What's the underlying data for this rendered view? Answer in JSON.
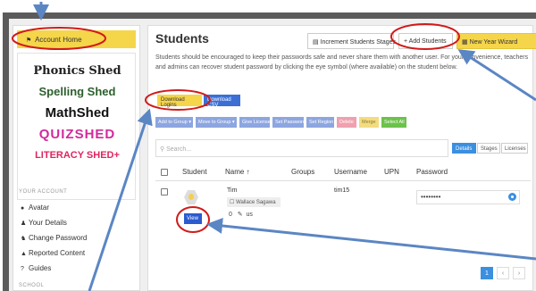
{
  "sidebar": {
    "account_home": "Account Home",
    "logos": [
      "Phonics Shed",
      "Spelling Shed",
      "MathShed",
      "QUIZSHED",
      "LITERACY SHED+"
    ],
    "your_account_heading": "YOUR ACCOUNT",
    "items": [
      {
        "icon": "user-icon",
        "label": "Avatar"
      },
      {
        "icon": "id-card-icon",
        "label": "Your Details"
      },
      {
        "icon": "key-icon",
        "label": "Change Password"
      },
      {
        "icon": "warning-icon",
        "label": "Reported Content"
      },
      {
        "icon": "question-icon",
        "label": "Guides"
      }
    ],
    "school_heading": "SCHOOL"
  },
  "main": {
    "title": "Students",
    "description": "Students should be encouraged to keep their passwords safe and never share them with another user. For your convenience, teachers and admins can recover student password by clicking the eye symbol (where available) on the student below.",
    "header_buttons": {
      "increment": "Increment Students Stages",
      "add": "+ Add Students",
      "wizard": "New Year Wizard"
    },
    "download_logins": "Download Logins",
    "download_csv": "Download CSV",
    "actions": [
      "Add to Group ▾",
      "Move to Group ▾",
      "Give License",
      "Set Password",
      "Set Region",
      "Delete",
      "Merge",
      "Select All"
    ],
    "search_placeholder": "Search...",
    "view_tabs": [
      "Details",
      "Stages",
      "Licenses"
    ],
    "columns": [
      "Student",
      "Name ↑",
      "Groups",
      "Username",
      "UPN",
      "Password"
    ],
    "rows": [
      {
        "name": "Tim",
        "teacher": "Wallace Sagawa",
        "count": "0",
        "initials": "us",
        "username": "tim15",
        "password": "••••••••",
        "view_label": "View"
      }
    ],
    "pagination": [
      "1",
      "‹",
      "›"
    ]
  },
  "colors": {
    "highlight_yellow": "#f5d54a",
    "primary_blue": "#3b6fd6",
    "annotation_red": "#d11a1a",
    "arrow_blue": "#5b86c4"
  }
}
